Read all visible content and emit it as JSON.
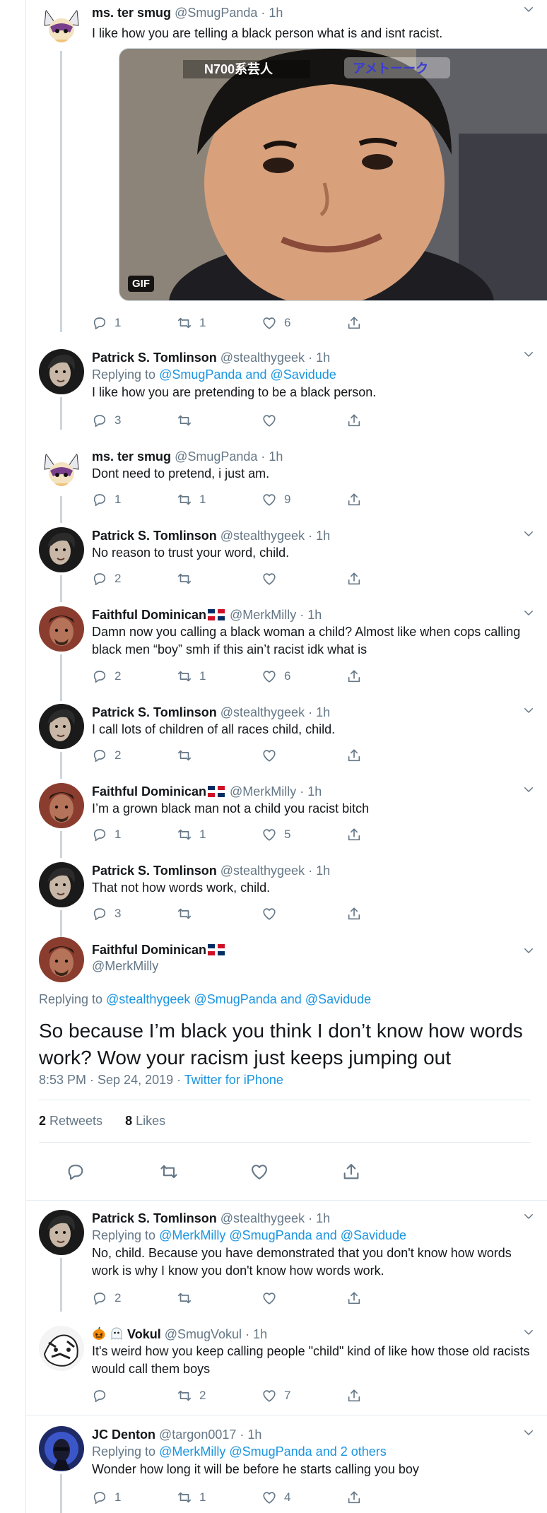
{
  "tweets": [
    {
      "name": "ms. ter smug",
      "handle": "@SmugPanda",
      "time": "· 1h",
      "text": "I like how you are telling a black person what is and isnt racist.",
      "reply": "1",
      "retweet": "1",
      "like": "6",
      "gif_label": "GIF",
      "gif_caption_left": "N700系芸人",
      "gif_caption_right": "アメトーーク"
    },
    {
      "name": "Patrick S. Tomlinson",
      "handle": "@stealthygeek",
      "time": "· 1h",
      "replying_prefix": "Replying to",
      "replying_to": "@SmugPanda and @Savidude",
      "text": "I like how you are pretending to be a black person.",
      "reply": "3",
      "retweet": "",
      "like": ""
    },
    {
      "name": "ms. ter smug",
      "handle": "@SmugPanda",
      "time": "· 1h",
      "text": "Dont need to pretend, i just am.",
      "reply": "1",
      "retweet": "1",
      "like": "9"
    },
    {
      "name": "Patrick S. Tomlinson",
      "handle": "@stealthygeek",
      "time": "· 1h",
      "text": "No reason to trust your word, child.",
      "reply": "2",
      "retweet": "",
      "like": ""
    },
    {
      "name": "Faithful Dominican",
      "handle": "@MerkMilly",
      "time": "· 1h",
      "text": "Damn now you calling a black woman a child? Almost like when cops calling black men “boy” smh if this ain’t racist idk what is",
      "reply": "2",
      "retweet": "1",
      "like": "6"
    },
    {
      "name": "Patrick S. Tomlinson",
      "handle": "@stealthygeek",
      "time": "· 1h",
      "text": "I call lots of children of all races child, child.",
      "reply": "2",
      "retweet": "",
      "like": ""
    },
    {
      "name": "Faithful Dominican",
      "handle": "@MerkMilly",
      "time": "· 1h",
      "text": "I’m a grown black man not a child you racist bitch",
      "reply": "1",
      "retweet": "1",
      "like": "5"
    },
    {
      "name": "Patrick S. Tomlinson",
      "handle": "@stealthygeek",
      "time": "· 1h",
      "text": "That not how words work, child.",
      "reply": "3",
      "retweet": "",
      "like": ""
    }
  ],
  "focus": {
    "name": "Faithful Dominican",
    "handle": "@MerkMilly",
    "replying_prefix": "Replying to",
    "replying_to": "@stealthygeek @SmugPanda and @Savidude",
    "text": "So because I’m black you think I don’t know how words work? Wow your racism just keeps jumping out",
    "timestamp": "8:53 PM · Sep 24, 2019 · ",
    "source": "Twitter for iPhone",
    "retweets_count": "2",
    "retweets_label": " Retweets",
    "likes_count": "8",
    "likes_label": " Likes"
  },
  "replies": [
    {
      "name": "Patrick S. Tomlinson",
      "handle": "@stealthygeek",
      "time": "· 1h",
      "replying_prefix": "Replying to",
      "replying_to": "@MerkMilly @SmugPanda and @Savidude",
      "text": "No, child. Because you have demonstrated that you don't know how words work is why I know you don't know how words work.",
      "reply": "2",
      "retweet": "",
      "like": ""
    },
    {
      "name": "Vokul",
      "handle": "@SmugVokul",
      "time": "· 1h",
      "text": "It's weird how you keep calling people \"child\" kind of like how those old racists would call them boys",
      "reply": "",
      "retweet": "2",
      "like": "7"
    },
    {
      "name": "JC Denton",
      "handle": "@targon0017",
      "time": "· 1h",
      "replying_prefix": "Replying to",
      "replying_to": "@MerkMilly @SmugPanda and 2 others",
      "text": "Wonder how long it will be before he starts calling you boy",
      "reply": "1",
      "retweet": "1",
      "like": "4"
    }
  ],
  "colors": {
    "link": "#1b95e0",
    "muted": "#657786",
    "text": "#14171a",
    "line": "#ccd6dd"
  },
  "icons": [
    "reply-icon",
    "retweet-icon",
    "like-icon",
    "share-icon",
    "chevron-down-icon"
  ]
}
